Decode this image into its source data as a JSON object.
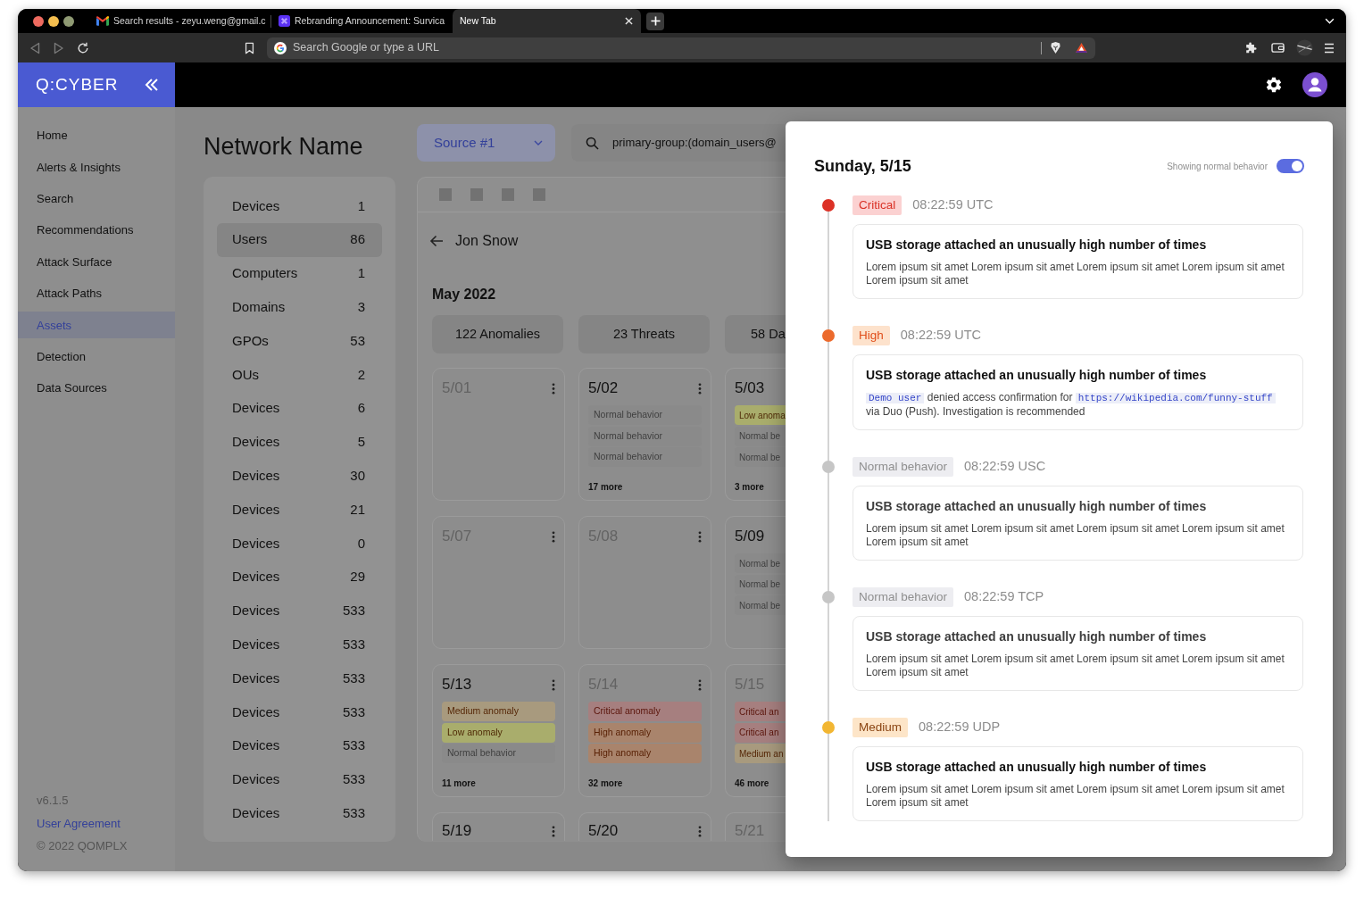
{
  "browser": {
    "tabs": [
      {
        "title": "Search results - zeyu.weng@gmail.c",
        "selected": false
      },
      {
        "title": "Rebranding Announcement: Survica",
        "selected": false
      },
      {
        "title": "New Tab",
        "selected": true
      }
    ],
    "address_bar": {
      "placeholder": "Search Google or type a URL"
    }
  },
  "app_header": {
    "logo": "Q:CYBER"
  },
  "sidebar": {
    "items": [
      {
        "label": "Home",
        "selected": false
      },
      {
        "label": "Alerts & Insights",
        "selected": false
      },
      {
        "label": "Search",
        "selected": false
      },
      {
        "label": "Recommendations",
        "selected": false
      },
      {
        "label": "Attack Surface",
        "selected": false
      },
      {
        "label": "Attack Paths",
        "selected": false
      },
      {
        "label": "Assets",
        "selected": true
      },
      {
        "label": "Detection",
        "selected": false
      },
      {
        "label": "Data Sources",
        "selected": false
      }
    ],
    "version": "v6.1.5",
    "user_agreement": "User Agreement",
    "copyright": "© 2022 QOMPLX"
  },
  "page": {
    "title": "Network Name"
  },
  "source_select": {
    "value": "Source #1"
  },
  "search": {
    "value": "primary-group:(domain_users@"
  },
  "asset_list": {
    "items": [
      {
        "label": "Devices",
        "count": "1",
        "selected": false
      },
      {
        "label": "Users",
        "count": "86",
        "selected": true
      },
      {
        "label": "Computers",
        "count": "1",
        "selected": false
      },
      {
        "label": "Domains",
        "count": "3",
        "selected": false
      },
      {
        "label": "GPOs",
        "count": "53",
        "selected": false
      },
      {
        "label": "OUs",
        "count": "2",
        "selected": false
      },
      {
        "label": "Devices",
        "count": "6",
        "selected": false
      },
      {
        "label": "Devices",
        "count": "5",
        "selected": false
      },
      {
        "label": "Devices",
        "count": "30",
        "selected": false
      },
      {
        "label": "Devices",
        "count": "21",
        "selected": false
      },
      {
        "label": "Devices",
        "count": "0",
        "selected": false
      },
      {
        "label": "Devices",
        "count": "29",
        "selected": false
      },
      {
        "label": "Devices",
        "count": "533",
        "selected": false
      },
      {
        "label": "Devices",
        "count": "533",
        "selected": false
      },
      {
        "label": "Devices",
        "count": "533",
        "selected": false
      },
      {
        "label": "Devices",
        "count": "533",
        "selected": false
      },
      {
        "label": "Devices",
        "count": "533",
        "selected": false
      },
      {
        "label": "Devices",
        "count": "533",
        "selected": false
      },
      {
        "label": "Devices",
        "count": "533",
        "selected": false
      }
    ]
  },
  "calendar": {
    "back_label": "Jon Snow",
    "month": "May 2022",
    "stats": [
      "122 Anomalies",
      "23 Threats",
      "58 Da"
    ],
    "days": [
      {
        "date": "5/01",
        "muted": true,
        "menu": true
      },
      {
        "date": "5/02",
        "muted": false,
        "menu": true,
        "events": [
          {
            "label": "Normal behavior",
            "kind": "normal"
          },
          {
            "label": "Normal behavior",
            "kind": "normal"
          },
          {
            "label": "Normal behavior",
            "kind": "normal"
          }
        ],
        "more": "17 more"
      },
      {
        "date": "5/03",
        "muted": false,
        "menu": false,
        "events": [
          {
            "label": "Low anoma",
            "kind": "low"
          },
          {
            "label": "Normal be",
            "kind": "normal"
          },
          {
            "label": "Normal be",
            "kind": "normal"
          }
        ],
        "more": "3 more"
      },
      {
        "date": "5/07",
        "muted": true,
        "menu": true
      },
      {
        "date": "5/08",
        "muted": true,
        "menu": true
      },
      {
        "date": "5/09",
        "muted": false,
        "menu": false,
        "events": [
          {
            "label": "Normal be",
            "kind": "normal"
          },
          {
            "label": "Normal be",
            "kind": "normal"
          },
          {
            "label": "Normal be",
            "kind": "normal"
          }
        ]
      },
      {
        "date": "5/13",
        "muted": false,
        "menu": true,
        "events": [
          {
            "label": "Medium anomaly",
            "kind": "medium"
          },
          {
            "label": "Low anomaly",
            "kind": "low"
          },
          {
            "label": "Normal behavior",
            "kind": "normal"
          }
        ],
        "more": "11 more"
      },
      {
        "date": "5/14",
        "muted": true,
        "menu": true,
        "events": [
          {
            "label": "Critical anomaly",
            "kind": "critical"
          },
          {
            "label": "High anomaly",
            "kind": "high"
          },
          {
            "label": "High anomaly",
            "kind": "high"
          }
        ],
        "more": "32 more"
      },
      {
        "date": "5/15",
        "muted": true,
        "menu": false,
        "events": [
          {
            "label": "Critical an",
            "kind": "critical"
          },
          {
            "label": "Critical an",
            "kind": "critical"
          },
          {
            "label": "Medium an",
            "kind": "medium"
          }
        ],
        "more": "46 more"
      },
      {
        "date": "5/19",
        "muted": false,
        "menu": true
      },
      {
        "date": "5/20",
        "muted": false,
        "menu": true
      },
      {
        "date": "5/21",
        "muted": true,
        "menu": false
      }
    ]
  },
  "detail_panel": {
    "title": "Sunday, 5/15",
    "toggle": {
      "label": "Showing normal behavior",
      "on": true
    },
    "events": [
      {
        "kind": "critical",
        "color": "#dc3126",
        "badge": "Critical",
        "time": "08:22:59 UTC",
        "title": "USB storage attached an unusually high number of times",
        "description": "Lorem ipsum sit amet Lorem ipsum sit amet Lorem ipsum sit amet Lorem ipsum sit amet Lorem ipsum sit amet"
      },
      {
        "kind": "high",
        "color": "#ec6a2c",
        "badge": "High",
        "time": "08:22:59 UTC",
        "title": "USB storage attached an unusually high number of times",
        "description_parts": [
          {
            "kind": "link",
            "text": "Demo user"
          },
          {
            "kind": "text",
            "text": "denied access confirmation for"
          },
          {
            "kind": "link",
            "text": "https://wikipedia.com/funny-stuff"
          },
          {
            "kind": "text",
            "text": "via Duo (Push). Investigation is recommended"
          }
        ]
      },
      {
        "kind": "normal",
        "color": "#c6c6c6",
        "badge": "Normal behavior",
        "time": "08:22:59 USC",
        "title": "USB storage attached an unusually high number of times",
        "description": "Lorem ipsum sit amet Lorem ipsum sit amet Lorem ipsum sit amet Lorem ipsum sit amet Lorem ipsum sit amet"
      },
      {
        "kind": "normal",
        "color": "#c6c6c6",
        "badge": "Normal behavior",
        "time": "08:22:59 TCP",
        "title": "USB storage attached an unusually high number of times",
        "description": "Lorem ipsum sit amet Lorem ipsum sit amet Lorem ipsum sit amet Lorem ipsum sit amet Lorem ipsum sit amet"
      },
      {
        "kind": "medium",
        "color": "#f2b632",
        "badge": "Medium",
        "time": "08:22:59 UDP",
        "title": "USB storage attached an unusually high number of times",
        "description": "Lorem ipsum sit amet Lorem ipsum sit amet Lorem ipsum sit amet Lorem ipsum sit amet Lorem ipsum sit amet"
      }
    ]
  }
}
